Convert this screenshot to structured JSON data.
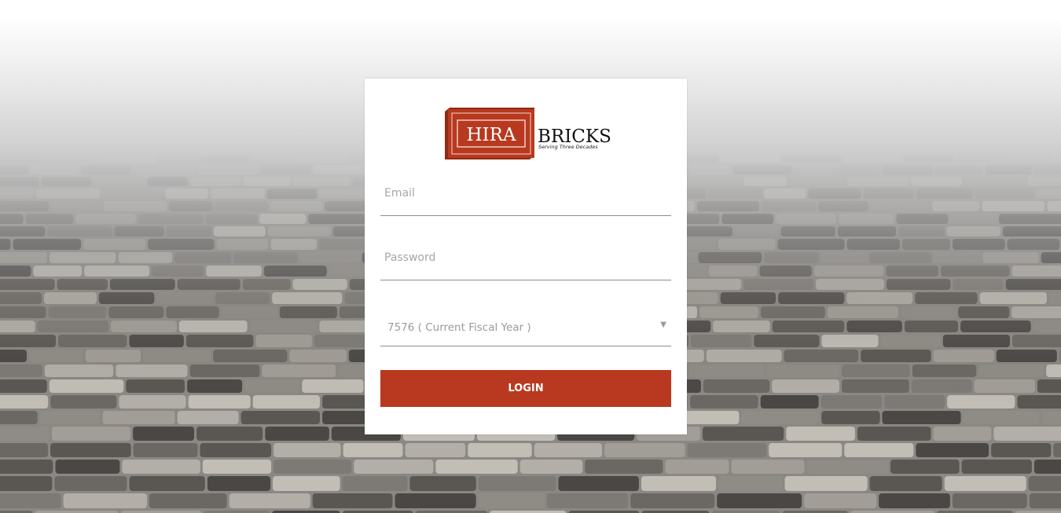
{
  "logo": {
    "brand_left": "HIRA",
    "brand_right": "BRICKS",
    "tagline": "Serving Three Decades",
    "brand_color": "#b8391f"
  },
  "form": {
    "email_placeholder": "Email",
    "password_placeholder": "Password",
    "fiscal_year": {
      "selected": "7576 ( Current Fiscal Year )",
      "arrow_icon": "caret-down-icon"
    },
    "login_label": "LOGIN"
  },
  "colors": {
    "button": "#b8391f",
    "card": "#ffffff"
  }
}
